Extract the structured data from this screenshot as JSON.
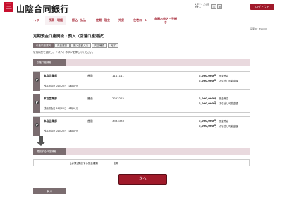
{
  "header": {
    "bank_name": "山陰合同銀行",
    "font_size_label": "文字サイズを変更する",
    "font_small": "小",
    "font_medium": "中",
    "logout_label": "ログアウト"
  },
  "nav": {
    "items": [
      {
        "label": "トップ"
      },
      {
        "label": "残高・明細"
      },
      {
        "label": "振込・払込"
      },
      {
        "label": "定期・積立"
      },
      {
        "label": "外貨"
      },
      {
        "label": "住宅ローン"
      },
      {
        "label": "各種お申込・手続き"
      }
    ]
  },
  "page": {
    "page_id": "画面ID：BSA003",
    "title": "定期預金口座開設・預入（引落口座選択）",
    "steps": [
      "引落口座選択",
      "商品選択",
      "預入金額入力",
      "内容確認",
      "完了"
    ],
    "instruction": "引落口座を選択し、「次へ」ボタンを押してください。",
    "withdraw_section": "引落口座情報",
    "dest_section": "開設する口座情報"
  },
  "accounts": [
    {
      "branch": "本店営業部",
      "type": "普通",
      "number": "1111111",
      "deposit_balance": "5,000,000円",
      "deposit_label": "預金残高",
      "available": "5,000,000円",
      "available_label": "お引出し可能金額",
      "balance_date": "残高照会日 01月22日 10時00分"
    },
    {
      "branch": "本店営業部",
      "type": "普通",
      "number": "2222222",
      "deposit_balance": "5,000,000円",
      "deposit_label": "預金残高",
      "available": "5,000,000円",
      "available_label": "お引出し可能金額",
      "balance_date": "残高照会日 01月22日 10時00分"
    },
    {
      "branch": "本店営業部",
      "type": "普通",
      "number": "3333333",
      "deposit_balance": "5,000,000円",
      "deposit_label": "預金残高",
      "available": "5,000,000円",
      "available_label": "お引出し可能金額",
      "balance_date": "残高照会日 01月22日 10時00分"
    }
  ],
  "destination": {
    "label": "[必須] 開設する預金種類",
    "value": "定期"
  },
  "buttons": {
    "next": "次へ",
    "back": "戻る"
  },
  "colors": {
    "brand": "#a01a2a",
    "panel": "#7b6d70",
    "band": "#e9d9de"
  }
}
